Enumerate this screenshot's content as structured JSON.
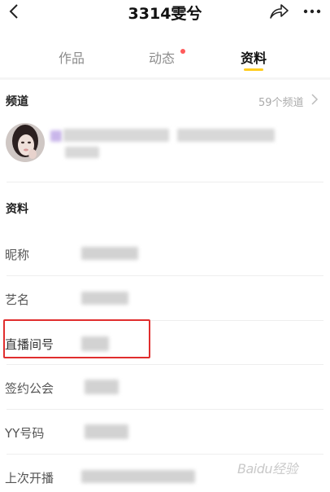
{
  "header": {
    "title": "3314雯兮",
    "back_icon": "chevron-left-icon",
    "share_icon": "share-icon",
    "more_icon": "more-icon"
  },
  "tabs": [
    {
      "label": "作品",
      "active": false
    },
    {
      "label": "动态",
      "active": false,
      "has_dot": true
    },
    {
      "label": "资料",
      "active": true
    }
  ],
  "channels": {
    "title": "频道",
    "count_label": "59个频道"
  },
  "profile": {
    "title": "资料",
    "rows": [
      {
        "label": "昵称"
      },
      {
        "label": "艺名"
      },
      {
        "label": "直播间号",
        "highlighted": true
      },
      {
        "label": "签约公会"
      },
      {
        "label": "YY号码"
      },
      {
        "label": "上次开播"
      }
    ]
  },
  "watermark": "Baidu经验",
  "colors": {
    "accent_underline": "#ffcc1d",
    "notification_dot": "#ff5a5a",
    "highlight_box": "#e02e2e"
  }
}
